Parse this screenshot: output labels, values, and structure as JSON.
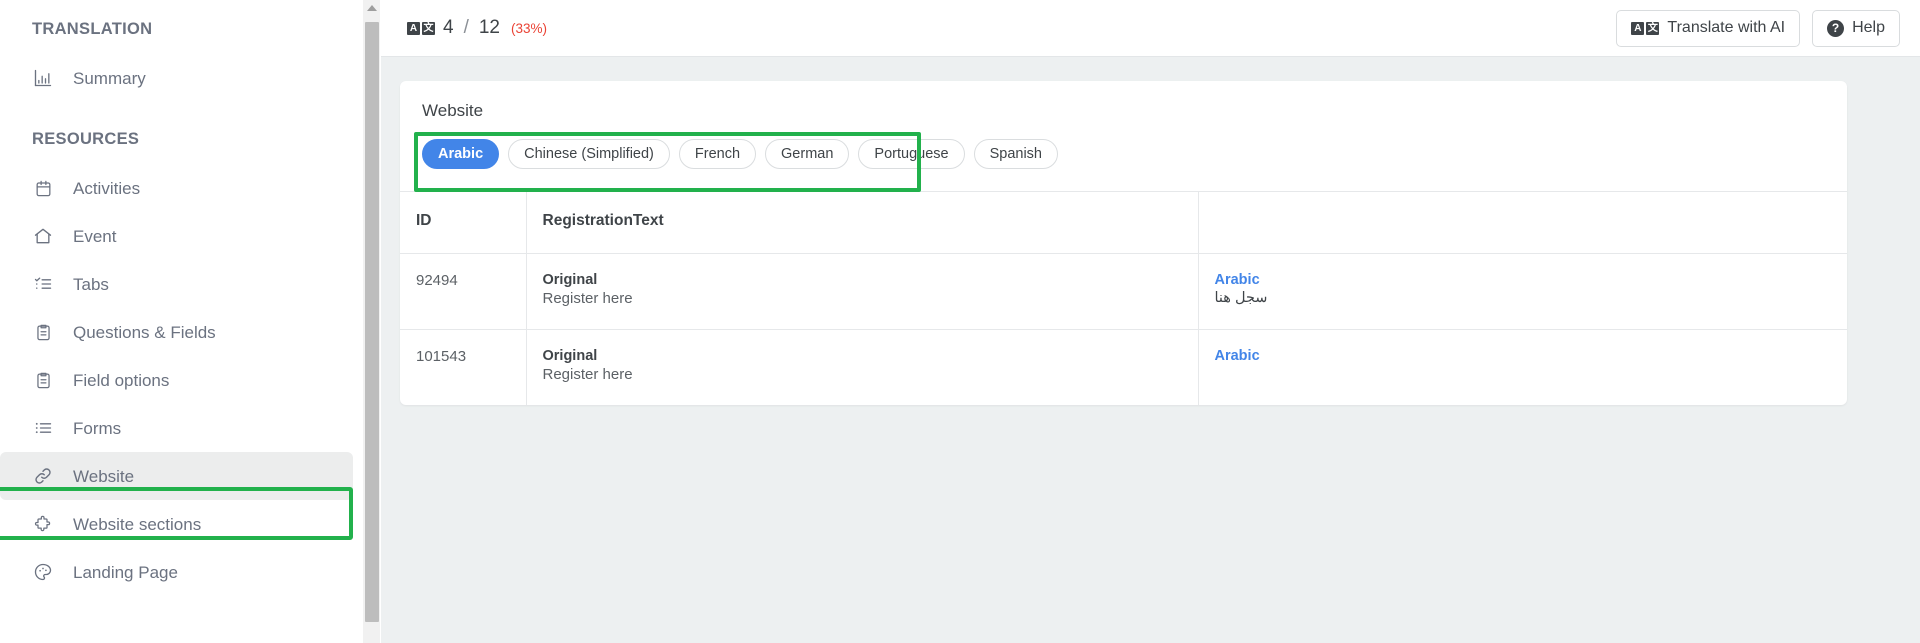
{
  "sidebar": {
    "groups": [
      {
        "title": "TRANSLATION",
        "items": [
          {
            "label": "Summary",
            "icon": "bar-chart-icon",
            "selected": false
          }
        ]
      },
      {
        "title": "RESOURCES",
        "items": [
          {
            "label": "Activities",
            "icon": "calendar-icon",
            "selected": false
          },
          {
            "label": "Event",
            "icon": "home-icon",
            "selected": false
          },
          {
            "label": "Tabs",
            "icon": "checklist-icon",
            "selected": false
          },
          {
            "label": "Questions & Fields",
            "icon": "clipboard-icon",
            "selected": false
          },
          {
            "label": "Field options",
            "icon": "clipboard-icon",
            "selected": false
          },
          {
            "label": "Forms",
            "icon": "list-icon",
            "selected": false
          },
          {
            "label": "Website",
            "icon": "link-icon",
            "selected": true
          },
          {
            "label": "Website sections",
            "icon": "puzzle-icon",
            "selected": false
          },
          {
            "label": "Landing Page",
            "icon": "palette-icon",
            "selected": false
          }
        ]
      }
    ]
  },
  "topbar": {
    "progress_icon": "translate-icon",
    "progress_glyph_left": "A",
    "progress_glyph_right": "文",
    "current": "4",
    "separator": "/",
    "total": "12",
    "percent": "(33%)",
    "percent_color": "#ea4335",
    "translate_button": "Translate with AI",
    "translate_button_icon": "translate-icon",
    "help_button": "Help",
    "help_button_icon": "help-circle-icon"
  },
  "card": {
    "title": "Website",
    "languages": [
      {
        "label": "Arabic",
        "active": true
      },
      {
        "label": "Chinese (Simplified)",
        "active": false
      },
      {
        "label": "French",
        "active": false
      },
      {
        "label": "German",
        "active": false
      },
      {
        "label": "Portuguese",
        "active": false
      },
      {
        "label": "Spanish",
        "active": false
      }
    ],
    "table": {
      "columns": [
        "ID",
        "RegistrationText",
        ""
      ],
      "rows": [
        {
          "id": "92494",
          "original_label": "Original",
          "original_text": "Register here",
          "translation_label": "Arabic",
          "translation_text": "سجل هنا"
        },
        {
          "id": "101543",
          "original_label": "Original",
          "original_text": "Register here",
          "translation_label": "Arabic",
          "translation_text": ""
        }
      ]
    }
  },
  "annotations": {
    "highlight_color": "#22b14c",
    "highlighted_elements": [
      "sidebar-item-website",
      "language-pill-group"
    ]
  }
}
